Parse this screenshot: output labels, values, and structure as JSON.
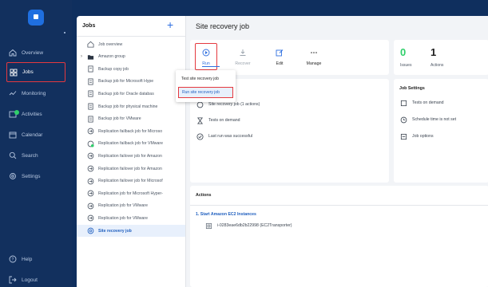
{
  "nav": {
    "items": [
      {
        "label": "Overview",
        "icon": "home-icon"
      },
      {
        "label": "Jobs",
        "icon": "jobs-grid-icon",
        "active": true
      },
      {
        "label": "Monitoring",
        "icon": "monitoring-icon"
      },
      {
        "label": "Activities",
        "icon": "activities-icon"
      },
      {
        "label": "Calendar",
        "icon": "calendar-icon"
      },
      {
        "label": "Search",
        "icon": "search-icon"
      },
      {
        "label": "Settings",
        "icon": "settings-icon"
      }
    ],
    "help": "Help",
    "logout": "Logout"
  },
  "jobs": {
    "title": "Jobs",
    "add_icon": "+",
    "items": [
      {
        "label": "Job overview",
        "icon": "overview-icon"
      },
      {
        "label": "Amazon group",
        "icon": "folder-icon",
        "expandable": true
      },
      {
        "label": "Backup copy job",
        "icon": "backup-copy-icon"
      },
      {
        "label": "Backup job for Microsoft Hype",
        "icon": "backup-job-icon"
      },
      {
        "label": "Backup job for Oracle databas",
        "icon": "backup-job-icon"
      },
      {
        "label": "Backup job for physical machine",
        "icon": "backup-job-icon"
      },
      {
        "label": "Backup job for VMware",
        "icon": "backup-job-icon"
      },
      {
        "label": "Replication failback job for Microso",
        "icon": "replication-icon"
      },
      {
        "label": "Replication failback job for VMware",
        "icon": "replication-icon-success"
      },
      {
        "label": "Replication failover job for Amazon",
        "icon": "replication-icon"
      },
      {
        "label": "Replication failover job for Amazon",
        "icon": "replication-icon"
      },
      {
        "label": "Replication failover job for Microsof",
        "icon": "replication-icon"
      },
      {
        "label": "Replication job for Microsoft Hyper-",
        "icon": "replication-icon"
      },
      {
        "label": "Replication job for VMware",
        "icon": "replication-icon"
      },
      {
        "label": "Replication job for VMware",
        "icon": "replication-icon"
      },
      {
        "label": "Site recovery job",
        "icon": "site-recovery-icon",
        "selected": true
      }
    ]
  },
  "main": {
    "title": "Site recovery job",
    "toolbar": {
      "run": "Run",
      "recover": "Recover",
      "edit": "Edit",
      "manage": "Manage"
    },
    "run_menu": {
      "items": [
        "Test site recovery job",
        "Run site recovery job"
      ]
    },
    "stats": {
      "issues_count": "0",
      "issues_label": "Issues",
      "actions_count": "1",
      "actions_label": "Actions"
    },
    "summary": {
      "rows": [
        {
          "text": "Site recovery job (1 actions)",
          "icon": "site-recovery-icon"
        },
        {
          "text": "Tests on demand",
          "icon": "hourglass-icon"
        },
        {
          "text": "Last run was successful",
          "icon": "check-circle-icon"
        }
      ]
    },
    "job_settings": {
      "title": "Job Settings",
      "rows": [
        {
          "text": "Tests on demand",
          "icon": "test-icon"
        },
        {
          "text": "Schedule time is not set",
          "icon": "schedule-icon"
        },
        {
          "text": "Job options",
          "icon": "job-options-icon"
        }
      ]
    },
    "actions": {
      "title": "Actions",
      "item_title": "1. Start Amazon EC2 Instances",
      "item_detail": "i-0283eae6db2b22998 (EC2Transporter)"
    }
  },
  "colors": {
    "nav_bg": "#12305e",
    "accent": "#2f6fe0",
    "highlight": "#e5393f",
    "success": "#2fcf6a"
  }
}
